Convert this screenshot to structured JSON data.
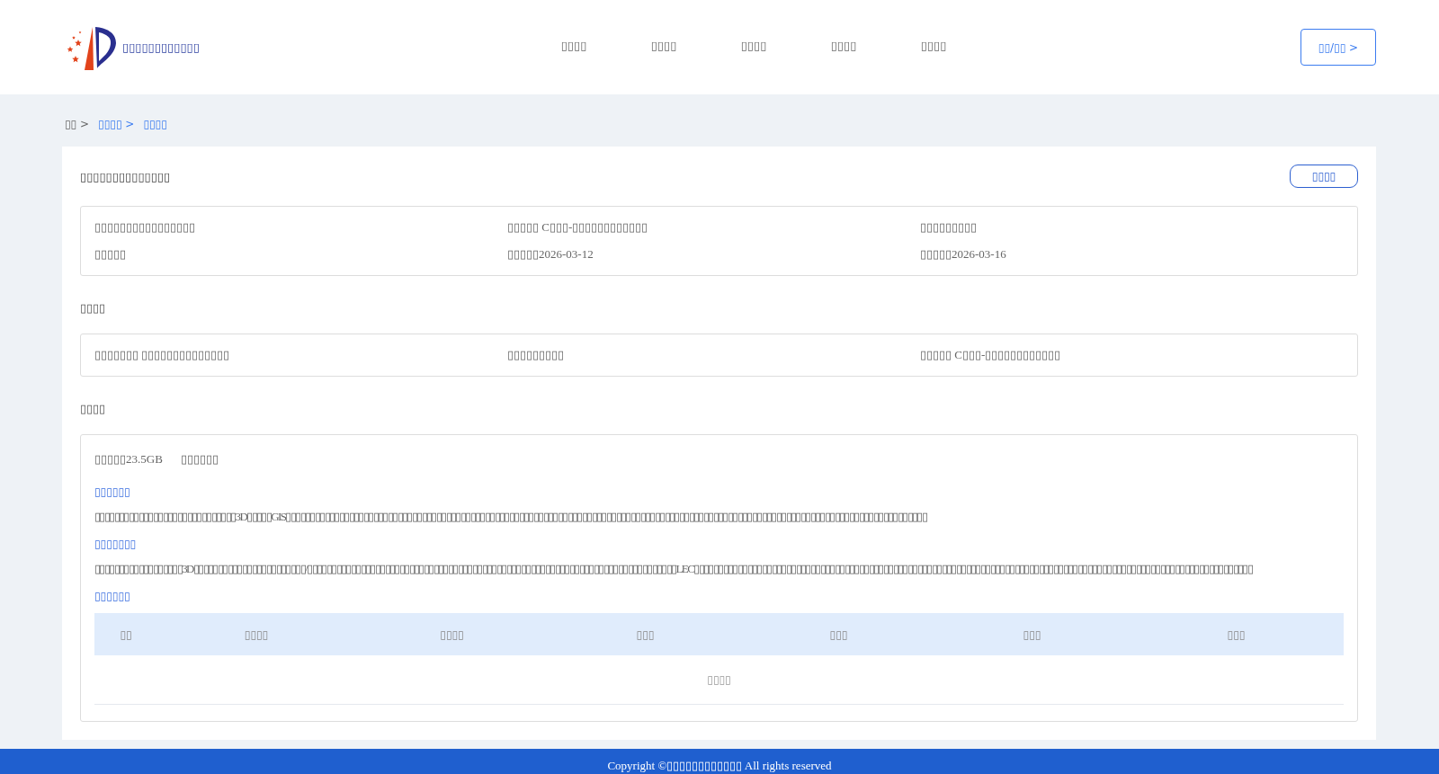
{
  "header": {
    "site_title": "▯▯▯▯▯▯▯▯▯▯▯▯",
    "nav": [
      {
        "label": "▯▯▯▯",
        "selected": false
      },
      {
        "label": "▯▯▯▯",
        "selected": false
      },
      {
        "label": "▯▯▯▯",
        "selected": false
      },
      {
        "label": "▯▯▯▯",
        "selected": false
      },
      {
        "label": "▯▯▯▯",
        "selected": false
      }
    ],
    "login_button": "▯▯/▯▯ >"
  },
  "breadcrumb": [
    {
      "label": "▯▯ >",
      "kind": "plain"
    },
    {
      "label": "▯▯▯▯ >",
      "kind": "link"
    },
    {
      "label": "▯▯▯▯",
      "kind": "link"
    }
  ],
  "card": {
    "title": "▯▯▯▯▯▯▯▯▯▯▯▯▯▯",
    "action_button": "▯▯▯▯",
    "info_rows": [
      [
        "▯▯▯▯▯▯▯▯▯▯▯▯▯▯▯▯",
        "▯▯▯▯▯ C▯▯▯-▯▯▯▯▯▯▯▯▯▯▯▯",
        "▯▯▯▯▯▯▯▯▯"
      ],
      [
        "▯▯▯▯▯",
        "▯▯▯▯▯2026-03-12",
        "▯▯▯▯▯2026-03-16"
      ]
    ],
    "section_2": {
      "title": "▯▯▯▯",
      "rows": [
        [
          "▯▯▯▯▯▯▯ ▯▯▯▯▯▯▯▯▯▯▯▯▯▯",
          "▯▯▯▯▯▯▯▯▯",
          "▯▯▯▯▯ C▯▯▯-▯▯▯▯▯▯▯▯▯▯▯▯"
        ]
      ]
    },
    "section_3": {
      "title": "▯▯▯▯",
      "meta": [
        "▯▯▯▯▯23.5GB",
        "▯▯▯▯▯▯"
      ],
      "blocks": [
        {
          "heading": "▯▯▯▯▯▯",
          "text": "▯▯▯▯▯▯▯▯▯▯▯▯▯▯▯▯▯▯▯▯▯▯▯▯▯▯▯▯▯3D▯▯▯▯▯GIS▯▯▯▯▯▯▯▯▯▯▯▯▯▯▯▯▯▯▯▯▯▯▯▯▯▯▯▯▯▯▯▯▯▯▯▯▯▯▯▯▯▯▯▯▯▯▯▯▯▯▯▯▯▯▯▯▯▯▯▯▯▯▯▯▯▯▯▯▯▯▯▯▯▯▯▯▯▯▯▯▯▯▯▯▯▯▯▯▯▯▯▯▯▯▯▯▯▯▯▯▯▯▯▯▯▯▯▯▯▯▯▯▯▯▯▯▯▯▯▯▯▯▯▯▯▯▯▯▯▯▯▯"
        },
        {
          "heading": "▯▯▯▯▯▯▯",
          "text": "▯▯▯▯▯▯▯▯▯▯▯▯▯▯▯▯▯▯3D▯▯▯▯▯▯▯▯▯▯▯▯▯▯▯▯▯▯▯▯▯▯▯/▯▯▯▯▯▯▯▯▯▯▯▯▯▯▯▯▯▯▯▯▯▯▯▯▯▯▯▯▯▯▯▯▯▯▯▯▯▯▯▯▯▯▯▯▯▯▯▯▯▯▯▯▯▯▯▯▯▯▯▯▯▯▯▯▯▯▯▯▯▯▯▯▯▯▯▯LEC▯▯▯▯▯▯▯▯▯▯▯▯▯▯▯▯▯▯▯▯▯▯▯▯▯▯▯▯▯▯▯▯▯▯▯▯▯▯▯▯▯▯▯▯▯▯▯▯▯▯▯▯▯▯▯▯▯▯▯▯▯▯▯▯▯▯▯▯▯▯▯▯▯▯▯▯▯▯▯▯▯▯▯▯▯▯▯▯▯▯▯▯▯▯▯▯▯▯▯▯▯▯▯▯▯▯▯▯▯▯▯▯▯▯▯"
        },
        {
          "heading": "▯▯▯▯▯▯",
          "table": {
            "columns": [
              "▯▯",
              "▯▯▯▯",
              "▯▯▯▯",
              "▯▯▯",
              "▯▯▯",
              "▯▯▯",
              "▯▯▯"
            ],
            "empty_text": "▯▯▯▯"
          }
        }
      ]
    }
  },
  "footer": {
    "text": "Copyright ©▯▯▯▯▯▯▯▯▯▯▯▯ All rights reserved"
  }
}
